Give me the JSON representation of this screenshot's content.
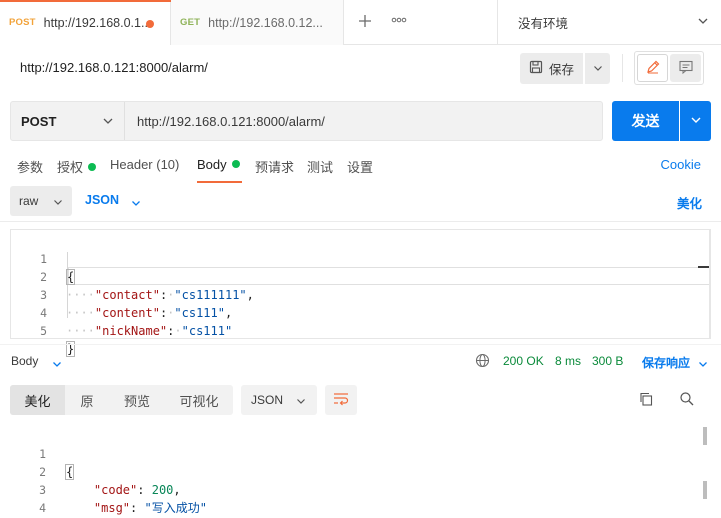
{
  "tabs": [
    {
      "method": "POST",
      "url": "http://192.168.0.1...",
      "unsaved": true
    },
    {
      "method": "GET",
      "url": "http://192.168.0.12..."
    }
  ],
  "tabbar": {
    "new_tab_icon": "plus-icon",
    "more_icon": "ellipsis-icon"
  },
  "environment": {
    "label": "没有环境"
  },
  "request": {
    "title": "http://192.168.0.121:8000/alarm/",
    "save_label": "保存",
    "method": "POST",
    "url": "http://192.168.0.121:8000/alarm/",
    "send_label": "发送"
  },
  "request_tabs": {
    "params": "参数",
    "auth": "授权",
    "headers": "Header (10)",
    "body": "Body",
    "prerequest": "预请求",
    "tests": "测试",
    "settings": "设置",
    "cookies": "Cookie"
  },
  "body_options": {
    "mode": "raw",
    "language": "JSON",
    "beautify": "美化"
  },
  "request_body": {
    "line_numbers": [
      "1",
      "2",
      "3",
      "4",
      "5"
    ],
    "open": "{",
    "close": "}",
    "fields": [
      {
        "key": "\"contact\"",
        "value": "\"cs111111\"",
        "trail": ","
      },
      {
        "key": "\"content\"",
        "value": "\"cs111\"",
        "trail": ","
      },
      {
        "key": "\"nickName\"",
        "value": "\"cs111\"",
        "trail": ""
      }
    ]
  },
  "response": {
    "body_label": "Body",
    "status": "200 OK",
    "time": "8 ms",
    "size": "300 B",
    "save_label": "保存响应",
    "view_tabs": [
      "美化",
      "原",
      "预览",
      "可视化"
    ],
    "format": "JSON",
    "line_numbers": [
      "1",
      "2",
      "3",
      "4"
    ],
    "open": "{",
    "close": "}",
    "code_key": "\"code\"",
    "code_value": "200",
    "msg_key": "\"msg\"",
    "msg_value": "\"写入成功\""
  },
  "colors": {
    "accent": "#f26b3a",
    "primary": "#097bed",
    "success": "#0cbb52",
    "status_text": "#0a8a3a"
  }
}
